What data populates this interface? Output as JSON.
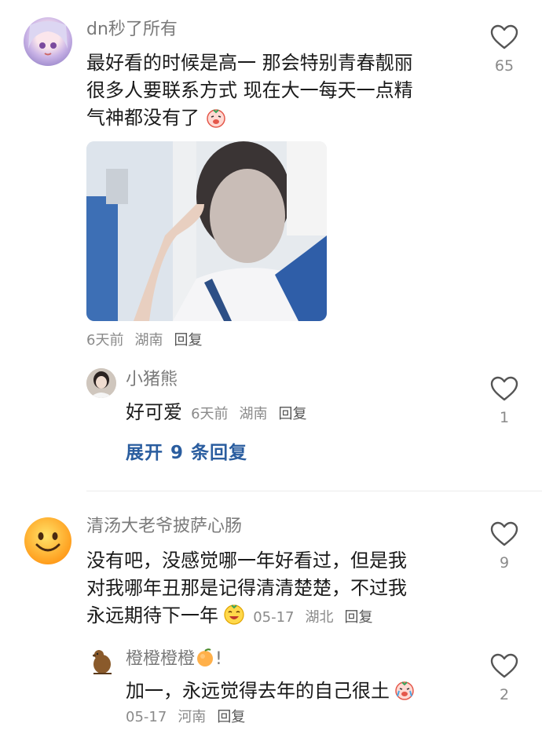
{
  "comments": [
    {
      "username": "dn秒了所有",
      "lines": [
        "最好看的时候是高一 那会特别青春靓丽",
        "很多人要联系方式 现在大一每天一点精",
        "气神都没有了"
      ],
      "time": "6天前",
      "location": "湖南",
      "reply_label": "回复",
      "likes": "65",
      "replies": [
        {
          "username": "小猪熊",
          "text": "好可爱",
          "time": "6天前",
          "location": "湖南",
          "reply_label": "回复",
          "likes": "1"
        }
      ],
      "expand_label": "展开 9 条回复"
    },
    {
      "username": "清汤大老爷披萨心肠",
      "lines": [
        "没有吧，没感觉哪一年好看过，但是我",
        "对我哪年丑那是记得清清楚楚，不过我",
        "永远期待下一年"
      ],
      "time": "05-17",
      "location": "湖北",
      "reply_label": "回复",
      "likes": "9",
      "replies": [
        {
          "username": "橙橙橙橙",
          "username_suffix": "!",
          "text": "加一，永远觉得去年的自己很土",
          "time": "05-17",
          "location": "河南",
          "reply_label": "回复",
          "likes": "2"
        }
      ]
    }
  ],
  "icons": {
    "like": "heart-outline-icon"
  },
  "colors": {
    "link": "#2a5d9f",
    "meta": "#8a8a8a",
    "name": "#7a7a7a"
  }
}
